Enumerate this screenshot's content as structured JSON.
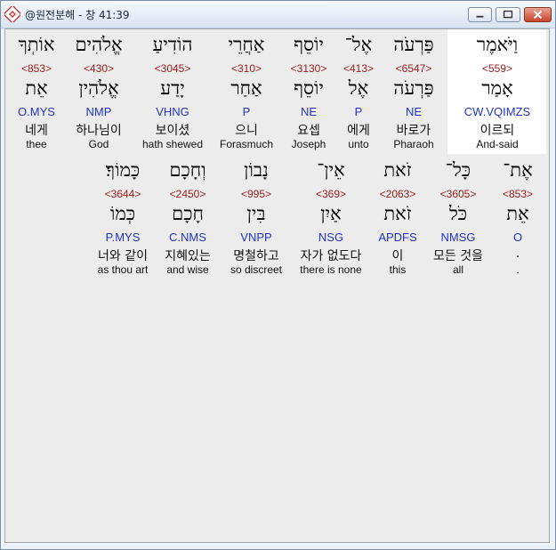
{
  "window": {
    "title": "@원전분해 - 창 41:39"
  },
  "row1": [
    {
      "heb": "אוֹתְךָ",
      "strong": "<853>",
      "root": "אֵת",
      "parse": "O.MYS",
      "kor": "네게",
      "eng": "thee"
    },
    {
      "heb": "אֱלֹהִים",
      "strong": "<430>",
      "root": "אֱלֹהִין",
      "parse": "NMP",
      "kor": "하나님이",
      "eng": "God"
    },
    {
      "heb": "הוֹדִיעַ",
      "strong": "<3045>",
      "root": "יָדַע",
      "parse": "VHNG",
      "kor": "보이셨",
      "eng": "hath shewed"
    },
    {
      "heb": "אַחֲרֵי",
      "strong": "<310>",
      "root": "אַחַר",
      "parse": "P",
      "kor": "으니",
      "eng": "Forasmuch"
    },
    {
      "heb": "יוֹסֵף",
      "strong": "<3130>",
      "root": "יוֹסֵף",
      "parse": "NE",
      "kor": "요셉",
      "eng": "Joseph"
    },
    {
      "heb": "אֶל־",
      "strong": "<413>",
      "root": "אֶל",
      "parse": "P",
      "kor": "에게",
      "eng": "unto"
    },
    {
      "heb": "פַּרְעֹה",
      "strong": "<6547>",
      "root": "פַּרְעֹה",
      "parse": "NE",
      "kor": "바로가",
      "eng": "Pharaoh"
    },
    {
      "heb": "וַיֹּאמֶר",
      "strong": "<559>",
      "root": "אָמַר",
      "parse": "CW.VQIMZS",
      "kor": "이르되",
      "eng": "And-said"
    }
  ],
  "row2": [
    {
      "heb": "כָּמוֹךָ׃",
      "strong": "<3644>",
      "root": "כְּמוֹ",
      "parse": "P.MYS",
      "kor": "너와 같이",
      "eng": "as thou art"
    },
    {
      "heb": "וְחָכָם",
      "strong": "<2450>",
      "root": "חָכָם",
      "parse": "C.NMS",
      "kor": "지혜있는",
      "eng": "and wise"
    },
    {
      "heb": "נָבוֹן",
      "strong": "<995>",
      "root": "בִּין",
      "parse": "VNPP",
      "kor": "명철하고",
      "eng": "so discreet"
    },
    {
      "heb": "אֵין־",
      "strong": "<369>",
      "root": "אַיִן",
      "parse": "NSG",
      "kor": "자가 없도다",
      "eng": "there is none"
    },
    {
      "heb": "זֹאת",
      "strong": "<2063>",
      "root": "זֹאת",
      "parse": "APDFS",
      "kor": "이",
      "eng": "this"
    },
    {
      "heb": "כָּל־",
      "strong": "<3605>",
      "root": "כֹּל",
      "parse": "NMSG",
      "kor": "모든 것을",
      "eng": "all"
    },
    {
      "heb": "אֶת־",
      "strong": "<853>",
      "root": "אֵת",
      "parse": "O",
      "kor": ".",
      "eng": "."
    }
  ]
}
